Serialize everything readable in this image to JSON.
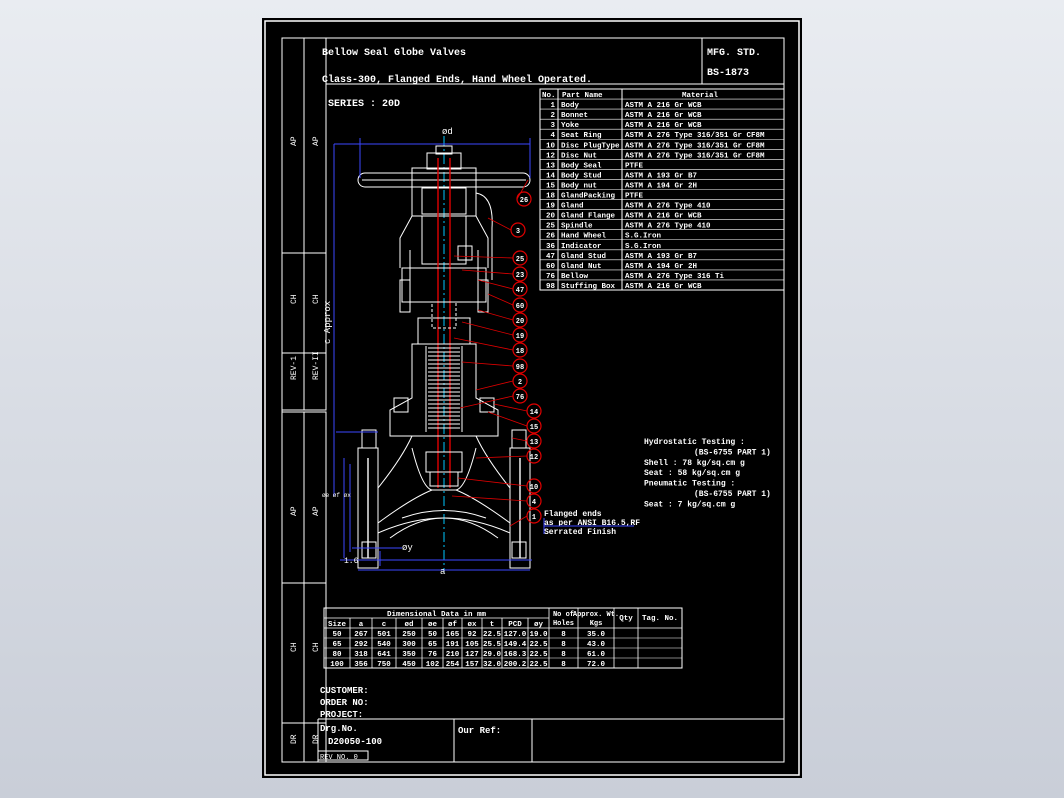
{
  "colors": {
    "background": "#000000",
    "lines": "#ffffff",
    "callouts": "#e00000",
    "dimensions": "#3b47ff",
    "centerline": "#00c8ff"
  },
  "title": {
    "line1": "Bellow Seal Globe Valves",
    "line2": "Class-300, Flanged Ends, Hand Wheel Operated.",
    "mfg_std_label": "MFG. STD.",
    "mfg_std_value": "BS-1873"
  },
  "series": "SERIES : 20D",
  "left_strip": [
    "AP",
    "AP",
    "CH",
    "CH",
    "REV-1",
    "REV-II",
    "AP",
    "AP",
    "CH",
    "CH",
    "DR",
    "DR"
  ],
  "parts_table": {
    "headers": [
      "No.",
      "Part Name",
      "Material"
    ],
    "rows": [
      [
        "1",
        "Body",
        "ASTM A 216 Gr WCB"
      ],
      [
        "2",
        "Bonnet",
        "ASTM A 216 Gr WCB"
      ],
      [
        "3",
        "Yoke",
        "ASTM A 216 Gr WCB"
      ],
      [
        "4",
        "Seat Ring",
        "ASTM A 276 Type 316/351 Gr CF8M"
      ],
      [
        "10",
        "Disc PlugType",
        "ASTM A 276 Type 316/351 Gr CF8M"
      ],
      [
        "12",
        "Disc Nut",
        "ASTM A 276 Type 316/351 Gr CF8M"
      ],
      [
        "13",
        "Body Seal",
        "PTFE"
      ],
      [
        "14",
        "Body Stud",
        "ASTM A 193 Gr B7"
      ],
      [
        "15",
        "Body nut",
        "ASTM A 194 Gr 2H"
      ],
      [
        "18",
        "GlandPacking",
        "PTFE"
      ],
      [
        "19",
        "Gland",
        "ASTM A 276 Type 410"
      ],
      [
        "20",
        "Gland Flange",
        "ASTM A 216 Gr WCB"
      ],
      [
        "25",
        "Spindle",
        "ASTM A 276 Type 410"
      ],
      [
        "26",
        "Hand Wheel",
        "S.G.Iron"
      ],
      [
        "36",
        "Indicator",
        "S.G.Iron"
      ],
      [
        "47",
        "Gland Stud",
        "ASTM A 193 Gr B7"
      ],
      [
        "60",
        "Gland Nut",
        "ASTM A 194 Gr 2H"
      ],
      [
        "76",
        "Bellow",
        "ASTM A 276 Type 316 Ti"
      ],
      [
        "98",
        "Stuffing Box",
        "ASTM A 216 Gr WCB"
      ]
    ]
  },
  "callouts": [
    "26",
    "3",
    "25",
    "23",
    "47",
    "60",
    "20",
    "19",
    "18",
    "98",
    "2",
    "76",
    "14",
    "15",
    "13",
    "12",
    "10",
    "4",
    "1"
  ],
  "drawing_labels": {
    "od": "ød",
    "c_approx": "c Approx",
    "a": "a",
    "oy": "øy",
    "dim_1_6": "1.6"
  },
  "flange_note": [
    "Flanged ends",
    "as per ANSI B16.5,RF",
    "Serrated Finish"
  ],
  "testing": [
    "Hydrostatic Testing :",
    "(BS-6755 PART 1)",
    "Shell : 78 kg/sq.cm g",
    "Seat  : 58 kg/sq.cm g",
    "Pneumatic Testing :",
    "(BS-6755 PART 1)",
    "Seat : 7 kg/sq.cm g"
  ],
  "dim_table": {
    "title": "Dimensional Data in mm",
    "headers": [
      "Size",
      "a",
      "c",
      "ød",
      "øe",
      "øf",
      "øx",
      "t",
      "PCD",
      "øy"
    ],
    "holes_header": "No of Holes",
    "weight_header": "Approx. Wt. Kgs",
    "qty_header": "Qty",
    "tag_header": "Tag. No.",
    "rows": [
      [
        "50",
        "267",
        "501",
        "250",
        "50",
        "165",
        "92",
        "22.5",
        "127.0",
        "19.0",
        "8",
        "35.0"
      ],
      [
        "65",
        "292",
        "540",
        "300",
        "65",
        "191",
        "105",
        "25.5",
        "149.4",
        "22.5",
        "8",
        "43.0"
      ],
      [
        "80",
        "318",
        "641",
        "350",
        "76",
        "210",
        "127",
        "29.0",
        "168.3",
        "22.5",
        "8",
        "61.0"
      ],
      [
        "100",
        "356",
        "750",
        "450",
        "102",
        "254",
        "157",
        "32.0",
        "200.2",
        "22.5",
        "8",
        "72.0"
      ]
    ]
  },
  "info": {
    "customer": "CUSTOMER:",
    "order": "ORDER NO:",
    "project": "PROJECT:",
    "drg_label": "Drg.No.",
    "drg_value": "D20050-100",
    "our_ref": "Our Ref:",
    "rev": "REV NO. 0"
  }
}
